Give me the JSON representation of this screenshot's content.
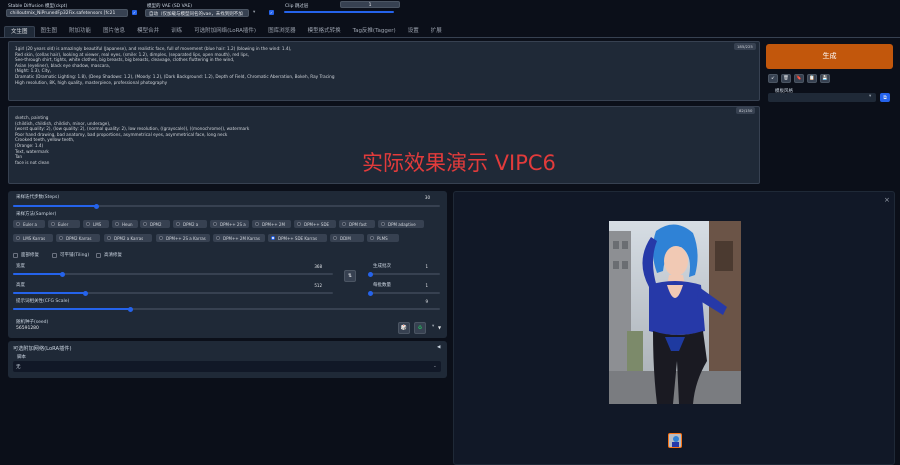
{
  "top": {
    "checkpoint_label": "Stable Diffusion 模型(ckpt)",
    "checkpoint_value": "chilloutmix_NiPrunedFp32Fix.safetensors [fc21",
    "vae_label": "模型的 VAE (SD VAE)",
    "vae_value": "自动（仅加载与模型同名的vae，未找到则不加",
    "clip_label": "Clip 跳过层",
    "clip_value": "1"
  },
  "tabs": [
    "文生图",
    "图生图",
    "附加功能",
    "图片信息",
    "模型合并",
    "训练",
    "可选附加网络(LoRA插件)",
    "图库浏览器",
    "模型格式转换",
    "Tag反推(Tagger)",
    "设置",
    "扩展"
  ],
  "prompt": {
    "counter": "185/225",
    "lines": [
      "1girl (20 years old) is amazingly beautiful (Japanese), and realistic face, full of movement (blue hair: 1.2) (blowing in the wind: 1.4),",
      "Red skin, (cellas hair), looking at viewer, real eyes, (smile: 1.2), dimples, (separated lips, open mouth), red lips,",
      "See-through shirt, tights, white clothes, big breasts, big breasts, cleavage, clothes fluttering in the wind,",
      "Asian (eyeliner), black eye shadow, mascara,",
      "(Night: 1.3), City,",
      "Dramatic (Dramatic Lighting: 1.8), (Deep Shadows: 1.2), (Moody: 1.2), (Dark Background: 1.2), Depth of Field, Chromatic Aberration, Bokeh, Ray Tracing",
      "High resolution, 8K, high quality, masterpiece, professional photography"
    ]
  },
  "negative": {
    "counter": "82/150",
    "lines": [
      "sketch, painting",
      "(childish, childish, childish, minor, underage),",
      "(worst quality: 2), (low quality: 2), (normal quality: 2), low resolution, ((grayscale)), ((monochrome)), watermark",
      "Poor hand drawing, bad anatomy, bad proportions, asymmetrical eyes, asymmetrical face, long neck",
      "Crooked teeth, yellow teeth,",
      "(Orange: 1.4)",
      "Text, watermark",
      "Tan",
      "face is not clean"
    ]
  },
  "watermark": "实际效果演示  VIPC6",
  "actions": {
    "generate": "生成",
    "styles_label": "模板风格",
    "tool_icons": [
      "↙",
      "🗑",
      "🔖",
      "📋",
      "💾"
    ]
  },
  "params": {
    "steps_label": "采样迭代步数(Steps)",
    "steps": 30,
    "sampler_label": "采样方法(Sampler)",
    "samplers": [
      "Euler a",
      "Euler",
      "LMS",
      "Heun",
      "DPM2",
      "DPM2 a",
      "DPM++ 2S a",
      "DPM++ 2M",
      "DPM++ SDE",
      "DPM fast",
      "DPM adaptive",
      "LMS Karras",
      "DPM2 Karras",
      "DPM2 a Karras",
      "DPM++ 2S a Karras",
      "DPM++ 2M Karras",
      "DPM++ SDE Karras",
      "DDIM",
      "PLMS"
    ],
    "selected_sampler": "DPM++ SDE Karras",
    "face_fix": "面部修复",
    "tiling": "可平铺(Tiling)",
    "hires": "高清修复",
    "width_label": "宽度",
    "width": 368,
    "height_label": "高度",
    "height": 512,
    "batch_count_label": "生成批次",
    "batch_count": 1,
    "batch_size_label": "每批数量",
    "batch_size": 1,
    "cfg_label": "提示词相关性(CFG Scale)",
    "cfg": 9,
    "seed_label": "随机种子(seed)",
    "seed": "56591280",
    "swap_icon": "⇅",
    "recycle_icon": "♻",
    "dice_icon": "🎲"
  },
  "lora": {
    "title": "可选附加网络(LoRA插件)",
    "script_label": "脚本",
    "script_value": "无"
  },
  "output": {
    "close_icon": "×"
  }
}
